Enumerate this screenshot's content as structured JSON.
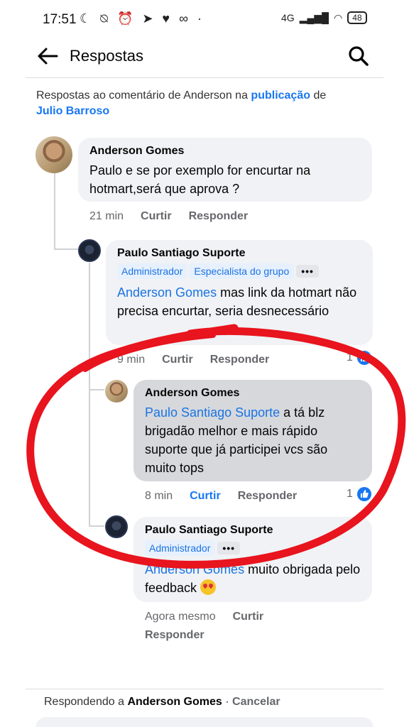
{
  "status_bar": {
    "time": "17:51",
    "battery": "48",
    "net": "4G"
  },
  "header": {
    "title": "Respostas"
  },
  "context": {
    "prefix": "Respostas ao comentário de Anderson na ",
    "link": "publicação",
    "middle": " de",
    "author": "Julio Barroso"
  },
  "comments": [
    {
      "author": "Anderson Gomes",
      "text": "Paulo e se por exemplo for encurtar na hotmart,será que aprova ?",
      "time": "21 min",
      "like": "Curtir",
      "reply": "Responder"
    },
    {
      "author": "Paulo Santiago Suporte",
      "badges": [
        "Administrador",
        "Especialista do grupo"
      ],
      "more": "•••",
      "mention": "Anderson Gomes",
      "text": " mas link da hotmart não precisa encurtar, seria desnecessário",
      "time": "9 min",
      "like": "Curtir",
      "reply": "Responder",
      "reactions": "1"
    },
    {
      "author": "Anderson Gomes",
      "mention": "Paulo Santiago Suporte",
      "text": " a tá blz brigadão melhor e mais rápido suporte que já participei vcs são muito tops",
      "time": "8 min",
      "like": "Curtir",
      "reply": "Responder",
      "reactions": "1"
    },
    {
      "author": "Paulo Santiago Suporte",
      "badges": [
        "Administrador"
      ],
      "more": "•••",
      "mention": "Anderson Gomes",
      "text": " muito obrigada pelo feedback ",
      "time": "Agora mesmo",
      "like": "Curtir",
      "reply": "Responder"
    }
  ],
  "footer": {
    "prefix": "Respondendo a ",
    "name": "Anderson Gomes",
    "separator": " · ",
    "cancel": "Cancelar"
  },
  "colors": {
    "accent": "#1877f2",
    "annotation": "#e8141e"
  }
}
